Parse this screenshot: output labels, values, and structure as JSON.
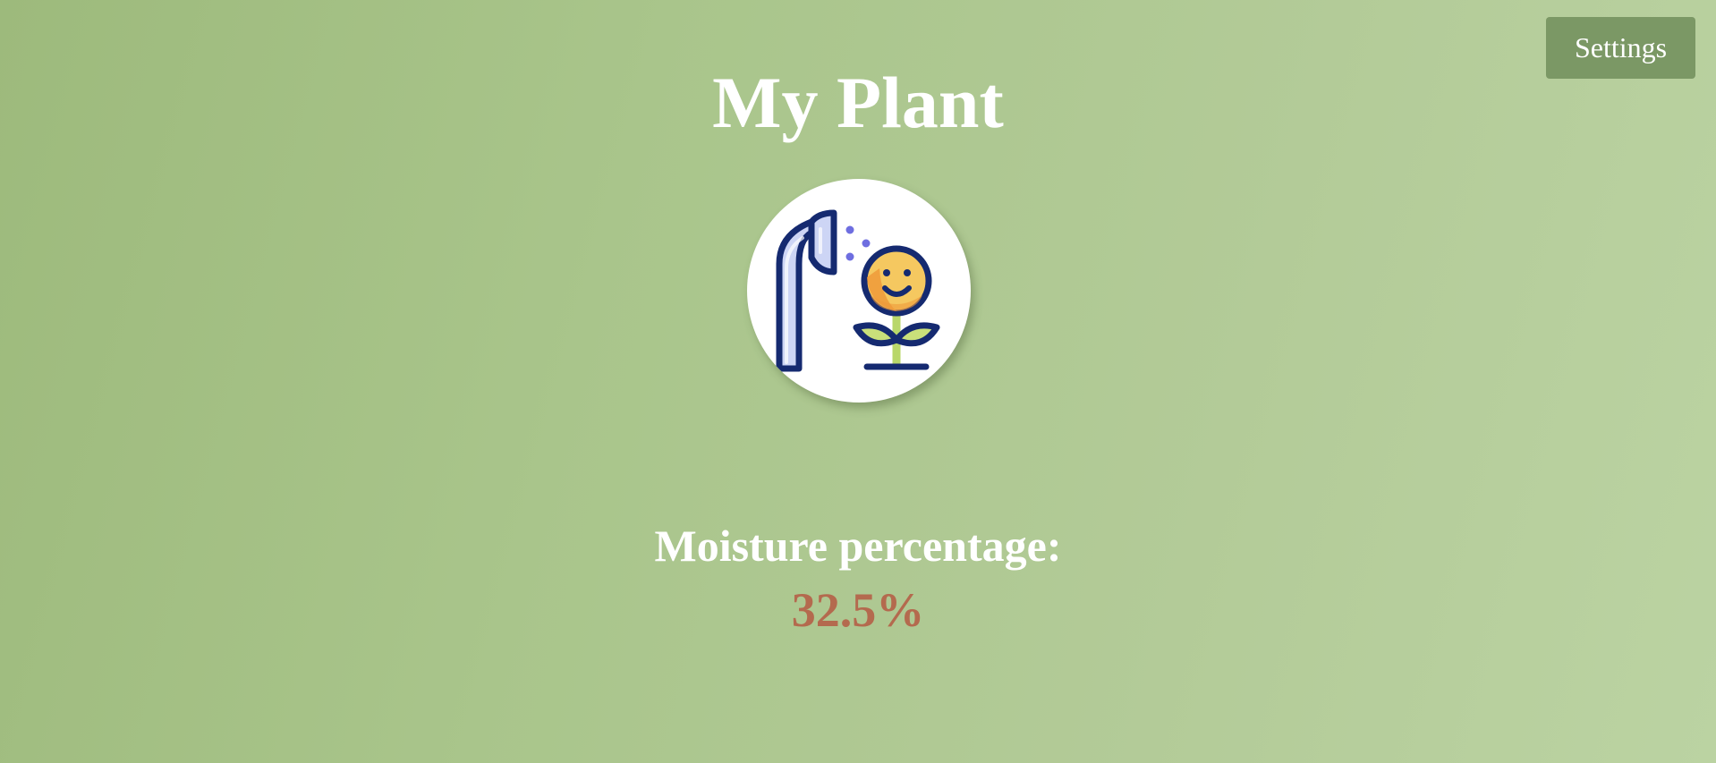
{
  "header": {
    "settings_label": "Settings"
  },
  "main": {
    "title": "My Plant",
    "plant_icon": "watering-plant-icon",
    "moisture_label": "Moisture percentage:",
    "moisture_value": "32.5%"
  },
  "colors": {
    "background_start": "#9dba7c",
    "background_end": "#bbd3a2",
    "settings_button": "#7b9865",
    "moisture_value": "#b46a4e",
    "text": "#ffffff"
  }
}
